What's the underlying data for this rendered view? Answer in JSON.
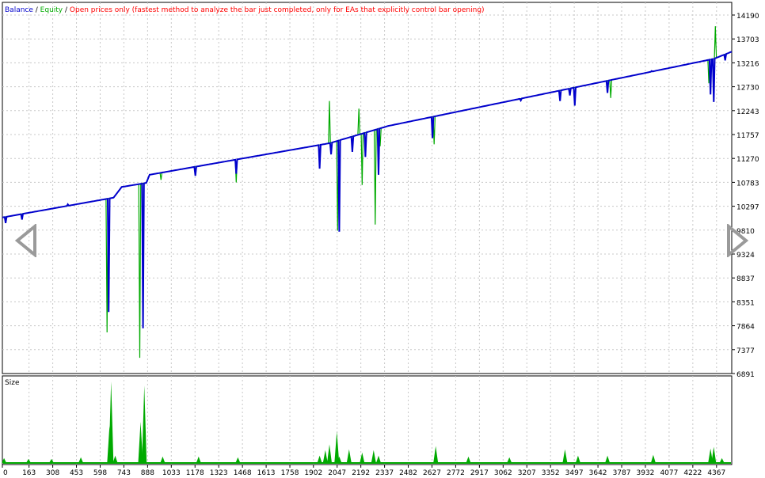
{
  "chart_data": [
    {
      "type": "line",
      "title": "",
      "legend": {
        "position": "top-left",
        "items": [
          {
            "label": "Balance",
            "color": "#0000cc"
          },
          {
            "label": "Equity",
            "color": "#00aa00"
          },
          {
            "label": "Open prices only (fastest method to analyze the bar just completed, only for EAs that explicitly control bar opening)",
            "color": "#ff0000"
          }
        ],
        "separator": " / "
      },
      "y_ticks": [
        "14190",
        "13703",
        "13216",
        "12730",
        "12243",
        "11757",
        "11270",
        "10783",
        "10297",
        "9810",
        "9324",
        "8837",
        "8351",
        "7864",
        "7377",
        "6891"
      ],
      "ylim": [
        6891,
        14190
      ],
      "xlim": [
        0,
        4460
      ],
      "grid": true,
      "series": [
        {
          "name": "Balance",
          "color": "#0000cc",
          "trend": [
            [
              0,
              9960
            ],
            [
              680,
              10350
            ],
            [
              730,
              10560
            ],
            [
              880,
              10640
            ],
            [
              900,
              10800
            ],
            [
              2000,
              11420
            ],
            [
              2360,
              11760
            ],
            [
              4350,
              13080
            ],
            [
              4460,
              13220
            ]
          ],
          "dips": [
            [
              20,
              9850
            ],
            [
              120,
              9920
            ],
            [
              400,
              10220
            ],
            [
              650,
              8100
            ],
            [
              860,
              7780
            ],
            [
              1180,
              10780
            ],
            [
              1430,
              10820
            ],
            [
              1940,
              10920
            ],
            [
              2010,
              11200
            ],
            [
              2060,
              9680
            ],
            [
              2140,
              11250
            ],
            [
              2220,
              11150
            ],
            [
              2300,
              10800
            ],
            [
              2630,
              11520
            ],
            [
              3170,
              12260
            ],
            [
              3410,
              12250
            ],
            [
              3470,
              12360
            ],
            [
              3500,
              12160
            ],
            [
              3700,
              12410
            ],
            [
              3970,
              12840
            ],
            [
              4330,
              12380
            ],
            [
              4350,
              12230
            ],
            [
              4420,
              13050
            ]
          ]
        },
        {
          "name": "Equity",
          "color": "#00aa00",
          "trend": [
            [
              0,
              9960
            ],
            [
              680,
              10350
            ],
            [
              730,
              10560
            ],
            [
              880,
              10640
            ],
            [
              900,
              10800
            ],
            [
              2000,
              11420
            ],
            [
              2360,
              11760
            ],
            [
              4350,
              13080
            ],
            [
              4460,
              13220
            ]
          ],
          "dips": [
            [
              640,
              7700
            ],
            [
              840,
              7200
            ],
            [
              970,
              10700
            ],
            [
              1430,
              10650
            ],
            [
              2000,
              12250
            ],
            [
              2050,
              9700
            ],
            [
              2180,
              12100
            ],
            [
              2200,
              10600
            ],
            [
              2280,
              9820
            ],
            [
              2310,
              11360
            ],
            [
              2640,
              11400
            ],
            [
              3720,
              12310
            ],
            [
              4320,
              12600
            ],
            [
              4360,
              13720
            ]
          ]
        }
      ]
    },
    {
      "type": "bar",
      "title": "Size",
      "color": "#00aa00",
      "x_ticks": [
        "0",
        "163",
        "308",
        "453",
        "598",
        "743",
        "888",
        "1033",
        "1178",
        "1323",
        "1468",
        "1613",
        "1758",
        "1902",
        "2047",
        "2192",
        "2337",
        "2482",
        "2627",
        "2772",
        "2917",
        "3062",
        "3207",
        "3352",
        "3497",
        "3642",
        "3787",
        "3932",
        "4077",
        "4222",
        "4367"
      ],
      "xlim": [
        0,
        4460
      ],
      "ylim": [
        0,
        1
      ],
      "grid": true,
      "spikes": [
        [
          10,
          0.05
        ],
        [
          160,
          0.04
        ],
        [
          300,
          0.04
        ],
        [
          480,
          0.06
        ],
        [
          655,
          0.45
        ],
        [
          665,
          1.0
        ],
        [
          690,
          0.08
        ],
        [
          845,
          0.5
        ],
        [
          868,
          0.95
        ],
        [
          980,
          0.07
        ],
        [
          1200,
          0.07
        ],
        [
          1440,
          0.06
        ],
        [
          1940,
          0.08
        ],
        [
          1975,
          0.15
        ],
        [
          2000,
          0.22
        ],
        [
          2045,
          0.38
        ],
        [
          2060,
          0.07
        ],
        [
          2120,
          0.16
        ],
        [
          2200,
          0.12
        ],
        [
          2270,
          0.15
        ],
        [
          2300,
          0.08
        ],
        [
          2650,
          0.2
        ],
        [
          2850,
          0.07
        ],
        [
          3100,
          0.06
        ],
        [
          3440,
          0.16
        ],
        [
          3520,
          0.08
        ],
        [
          3700,
          0.08
        ],
        [
          3980,
          0.09
        ],
        [
          4330,
          0.17
        ],
        [
          4350,
          0.19
        ],
        [
          4400,
          0.05
        ]
      ]
    }
  ],
  "ui": {
    "prev_icon": "chevron-left-icon",
    "next_icon": "chevron-right-icon"
  }
}
